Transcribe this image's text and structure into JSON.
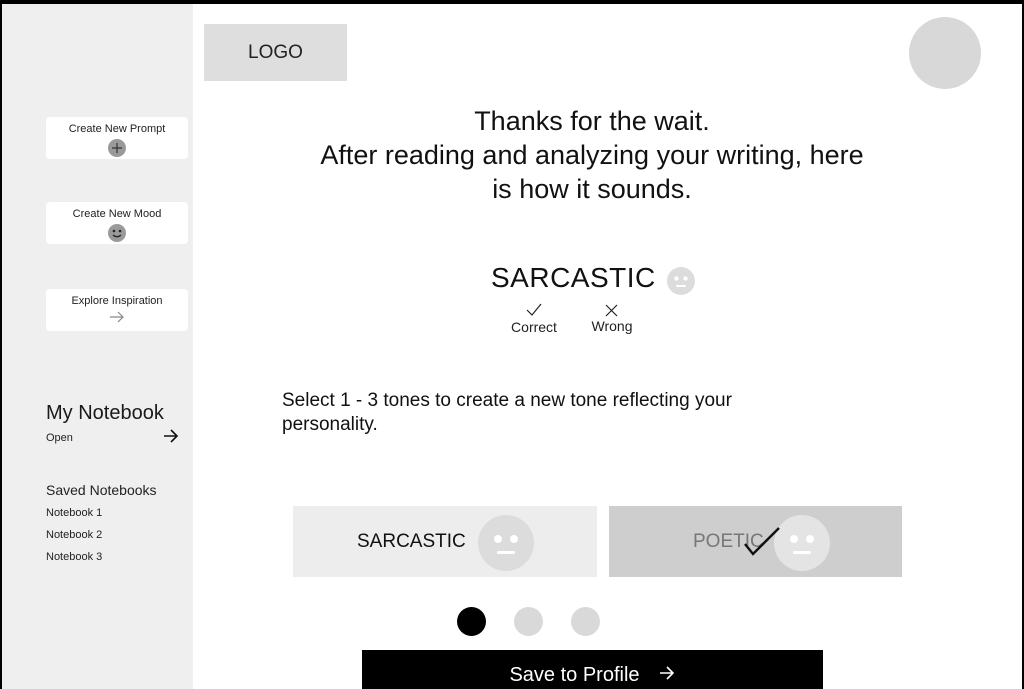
{
  "logo": "LOGO",
  "sidebar": {
    "actions": [
      {
        "label": "Create New Prompt",
        "icon": "plus-circle-icon"
      },
      {
        "label": "Create New Mood",
        "icon": "smiley-face-icon"
      },
      {
        "label": "Explore Inspiration",
        "icon": "arrow-right-icon"
      }
    ],
    "notebook": {
      "title": "My Notebook",
      "open_label": "Open"
    },
    "saved": {
      "title": "Saved Notebooks",
      "items": [
        "Notebook 1",
        "Notebook 2",
        "Notebook 3"
      ]
    }
  },
  "result": {
    "headline_lines": [
      "Thanks for the wait.",
      "After reading and analyzing your writing, here",
      "is how it sounds."
    ],
    "tone": "SARCASTIC",
    "correct_label": "Correct",
    "wrong_label": "Wrong"
  },
  "instruction": {
    "line1": "Select 1 - 3 tones to create a new tone reflecting your",
    "line2": "personality."
  },
  "tones": [
    {
      "label": "SARCASTIC",
      "selected": false
    },
    {
      "label": "POETIC",
      "selected": true
    }
  ],
  "pagination": {
    "pages": 3,
    "current": 1
  },
  "save_button": {
    "label": "Save to Profile"
  },
  "colors": {
    "sidebar_bg": "#efefef",
    "accent": "#000000",
    "tile_selected": "#cecece",
    "tile_default": "#ededed"
  }
}
